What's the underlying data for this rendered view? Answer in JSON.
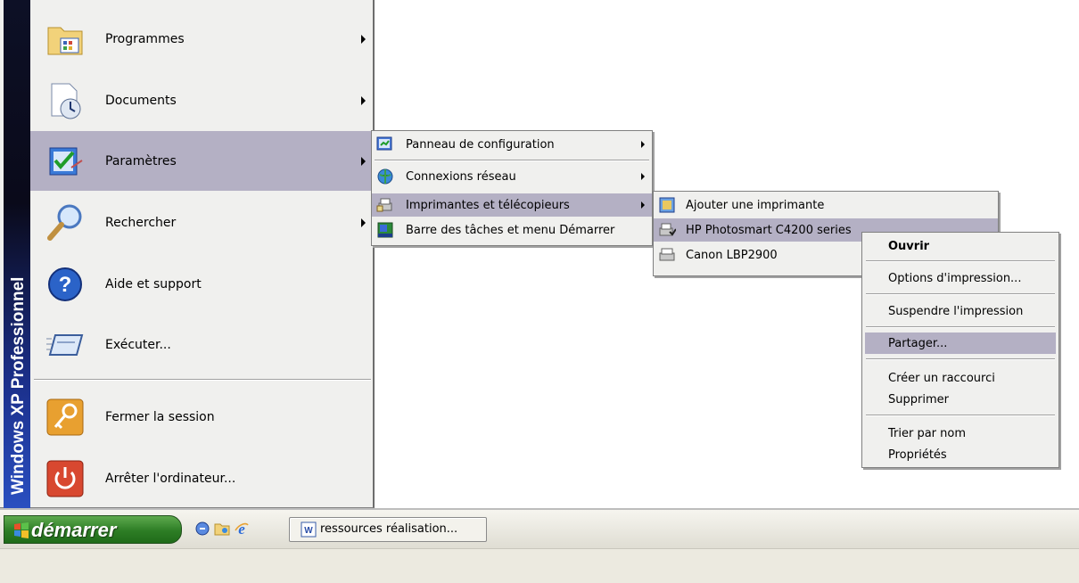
{
  "sidebar": {
    "text_bold": "Windows XP",
    "text_rest": "Professionnel"
  },
  "start_menu": {
    "items": [
      {
        "label": "Programmes",
        "icon": "programs-folder-icon",
        "has_submenu": true
      },
      {
        "label": "Documents",
        "icon": "documents-icon",
        "has_submenu": true
      },
      {
        "label": "Paramètres",
        "icon": "settings-icon",
        "has_submenu": true
      },
      {
        "label": "Rechercher",
        "icon": "search-icon",
        "has_submenu": true
      },
      {
        "label": "Aide et support",
        "icon": "help-icon",
        "has_submenu": false
      },
      {
        "label": "Exécuter...",
        "icon": "run-icon",
        "has_submenu": false
      },
      {
        "label": "Fermer la session",
        "icon": "logoff-key-icon",
        "has_submenu": false
      },
      {
        "label": "Arrêter l'ordinateur...",
        "icon": "power-icon",
        "has_submenu": false
      }
    ]
  },
  "settings_submenu": {
    "items": [
      {
        "label": "Panneau de configuration",
        "icon": "control-panel-icon"
      },
      {
        "label": "Connexions réseau",
        "icon": "network-icon"
      },
      {
        "label": "Imprimantes et télécopieurs",
        "icon": "printers-icon"
      },
      {
        "label": "Barre des tâches et menu Démarrer",
        "icon": "taskbar-icon"
      }
    ]
  },
  "printers_submenu": {
    "items": [
      {
        "label": "Ajouter une imprimante",
        "icon": "add-printer-icon"
      },
      {
        "label": "HP Photosmart C4200 series",
        "icon": "printer-default-icon"
      },
      {
        "label": "Canon LBP2900",
        "icon": "printer-icon"
      }
    ]
  },
  "context_menu": {
    "items": [
      {
        "label": "Ouvrir",
        "bold": true
      },
      {
        "label": "Options d'impression..."
      },
      {
        "label": "Suspendre l'impression"
      },
      {
        "label": "Partager..."
      },
      {
        "label": "Créer un raccourci"
      },
      {
        "label": "Supprimer"
      },
      {
        "label": "Trier par nom"
      },
      {
        "label": "Propriétés"
      }
    ]
  },
  "taskbar": {
    "start_label": "démarrer",
    "task_label": "ressources réalisation..."
  },
  "colors": {
    "highlight": "#b4b0c4",
    "menu_bg": "#f0f0ee",
    "start_green": "#2d7d25"
  }
}
